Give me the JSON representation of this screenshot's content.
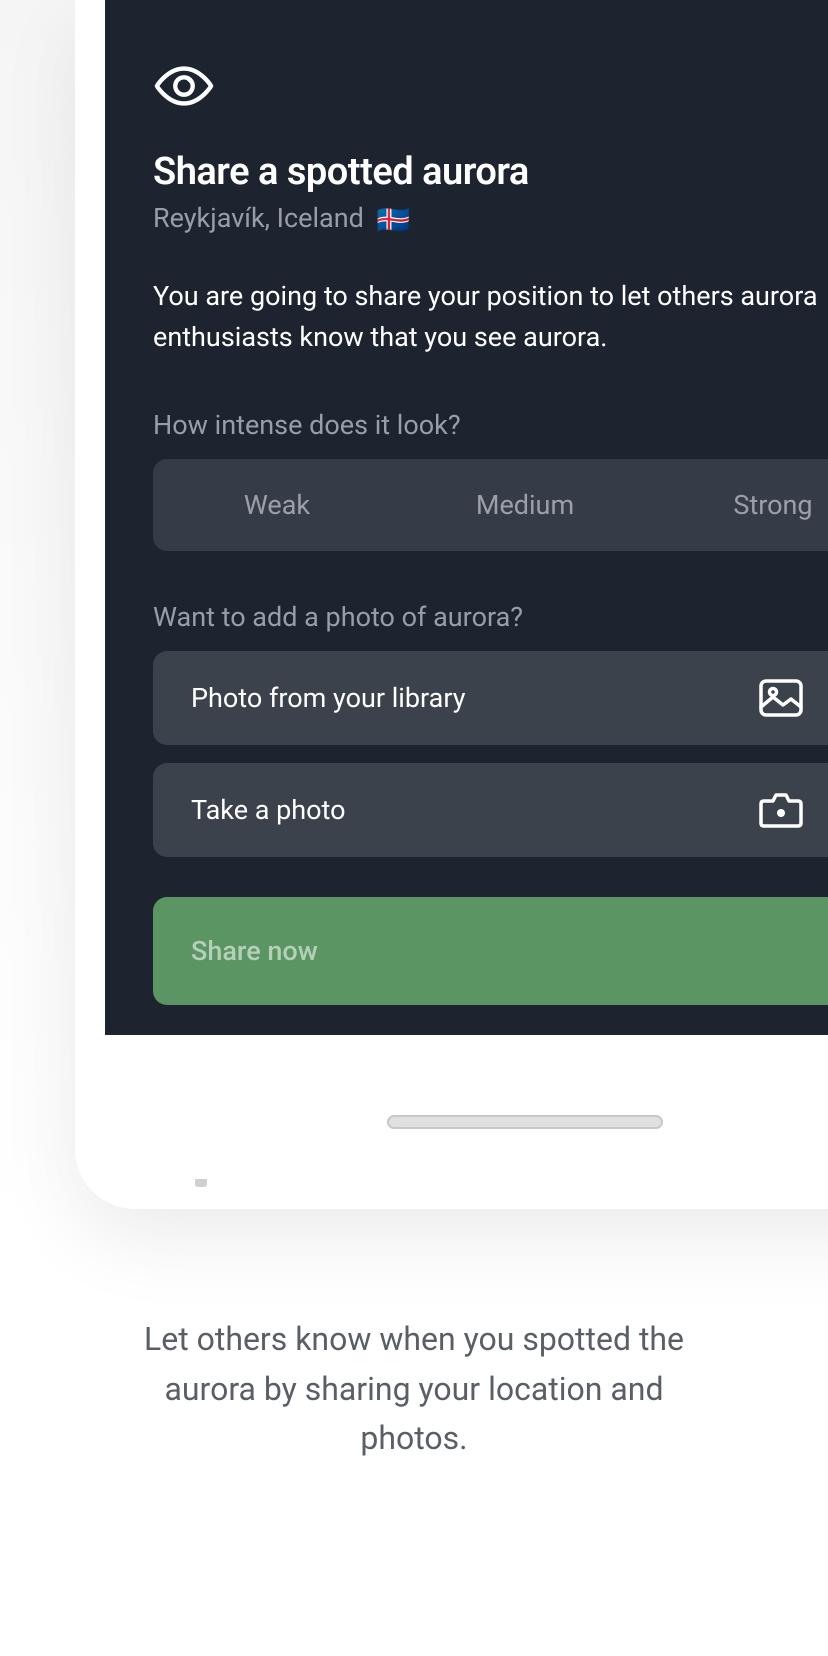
{
  "modal": {
    "title": "Share a spotted aurora",
    "location": "Reykjavík, Iceland",
    "flag": "🇮🇸",
    "description": "You are going to share your position to let others aurora enthusiasts know that you see aurora.",
    "intensity_label": "How intense does it look?",
    "intensity_options": [
      "Weak",
      "Medium",
      "Strong"
    ],
    "photo_label": "Want to add a photo of aurora?",
    "photo_buttons": [
      {
        "label": "Photo from your library"
      },
      {
        "label": "Take a photo"
      }
    ],
    "share_label": "Share now"
  },
  "caption": "Let others know when you spotted the aurora by sharing your location and photos."
}
